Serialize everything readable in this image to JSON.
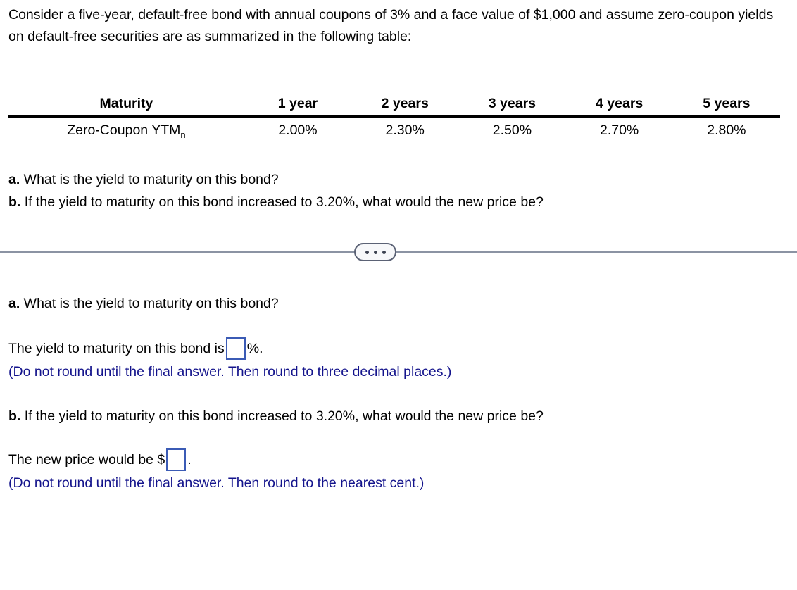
{
  "problem": {
    "intro": "Consider a five-year, default-free bond with annual coupons of 3% and a face value of $1,000 and assume zero-coupon yields on default-free securities are as summarized in the following table:",
    "table": {
      "header_label": "Maturity",
      "columns": [
        "1 year",
        "2 years",
        "3 years",
        "4 years",
        "5 years"
      ],
      "row_label": "Zero-Coupon YTM",
      "row_label_subscript": "n",
      "values": [
        "2.00%",
        "2.30%",
        "2.50%",
        "2.70%",
        "2.80%"
      ]
    },
    "questions": [
      {
        "marker": "a.",
        "text": " What is the yield to maturity on this bond?"
      },
      {
        "marker": "b.",
        "text": " If the yield to maturity on this bond increased to 3.20%, what would the new price be?"
      }
    ]
  },
  "divider": {
    "expand_button_label": "•••",
    "dot_count": 3,
    "line_color": "#8b93a3",
    "button_border_color": "#5b6275",
    "button_fill_color": "#f7f8fa"
  },
  "answer_section": {
    "part_a": {
      "marker": "a.",
      "question": " What is the yield to maturity on this bond?",
      "sentence_prefix": "The yield to maturity on this bond is ",
      "input_value": "",
      "input_placeholder": "",
      "sentence_suffix": "%.",
      "note": "(Do not round until the final answer. Then round to three decimal places.)"
    },
    "part_b": {
      "marker": "b.",
      "question": " If the yield to maturity on this bond increased to 3.20%, what would the new price be?",
      "sentence_prefix": "The new price would be $",
      "input_value": "",
      "input_placeholder": "",
      "sentence_suffix": ".",
      "note": "(Do not round until the final answer. Then round to the nearest cent.)"
    }
  },
  "colors": {
    "note_blue": "#14148c",
    "input_border_blue": "#3b5bb5",
    "text_black": "#000000"
  }
}
